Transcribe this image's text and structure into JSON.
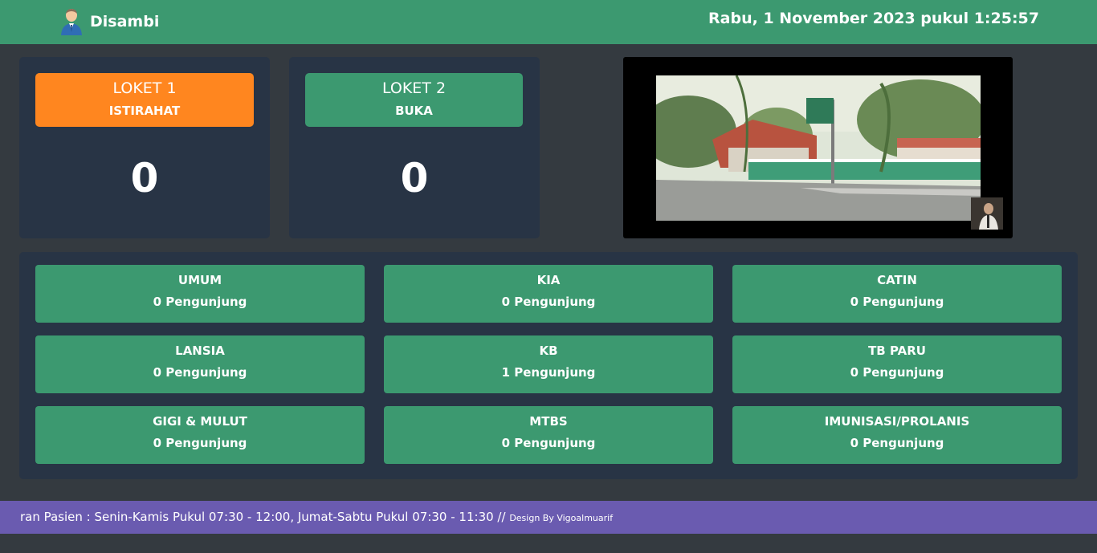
{
  "header": {
    "brand": "Disambi",
    "datetime": "Rabu, 1 November 2023 pukul 1:25:57",
    "colors": {
      "bar": "#3c9970"
    },
    "icon": "man-avatar-icon"
  },
  "lokets": [
    {
      "title": "LOKET 1",
      "status": "ISTIRAHAT",
      "number": "0",
      "color": "#ff861f"
    },
    {
      "title": "LOKET 2",
      "status": "BUKA",
      "number": "0",
      "color": "#3c9970"
    }
  ],
  "video": {
    "icon": "video-player",
    "thumbnail_icon": "presenter-thumbnail-icon"
  },
  "services": [
    {
      "name": "UMUM",
      "count": "0 Pengunjung"
    },
    {
      "name": "KIA",
      "count": "0 Pengunjung"
    },
    {
      "name": "CATIN",
      "count": "0 Pengunjung"
    },
    {
      "name": "LANSIA",
      "count": "0 Pengunjung"
    },
    {
      "name": "KB",
      "count": "1 Pengunjung"
    },
    {
      "name": "TB PARU",
      "count": "0 Pengunjung"
    },
    {
      "name": "GIGI & MULUT",
      "count": "0 Pengunjung"
    },
    {
      "name": "MTBS",
      "count": "0 Pengunjung"
    },
    {
      "name": "IMUNISASI/PROLANIS",
      "count": "0 Pengunjung"
    }
  ],
  "ticker": {
    "text": "ran Pasien : Senin-Kamis Pukul 07:30 - 12:00, Jumat-Sabtu Pukul 07:30 - 11:30 //",
    "credit": "Design By Vigoalmuarif",
    "color": "#6a5bb0"
  }
}
